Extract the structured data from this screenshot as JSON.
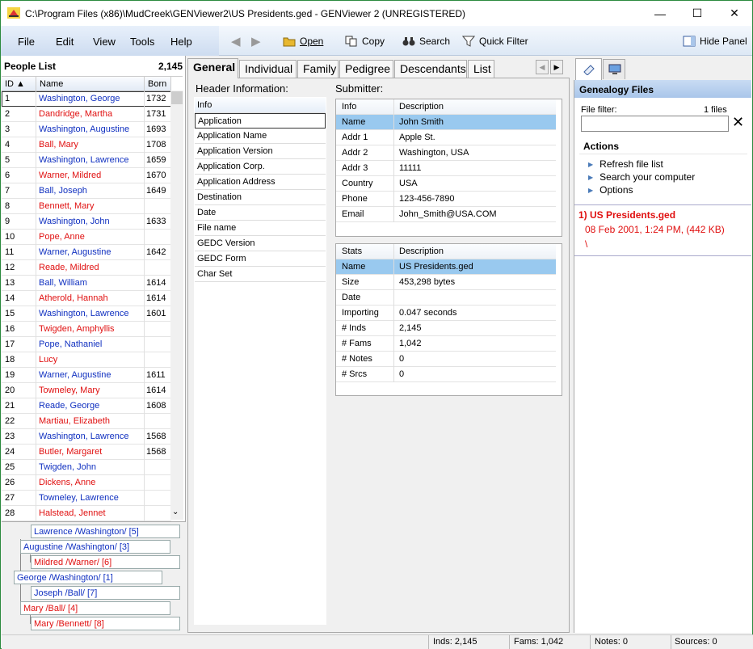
{
  "window": {
    "title": "C:\\Program Files (x86)\\MudCreek\\GENViewer2\\US Presidents.ged - GENViewer 2 (UNREGISTERED)",
    "minimize": "—",
    "maximize": "☐",
    "close": "✕"
  },
  "menu": [
    "File",
    "Edit",
    "View",
    "Tools",
    "Help"
  ],
  "toolbar": {
    "back": "◀",
    "forward": "▶",
    "open": "Open",
    "copy": "Copy",
    "search": "Search",
    "quick_filter": "Quick Filter",
    "hide_panel": "Hide Panel"
  },
  "people": {
    "title": "People List",
    "count": "2,145",
    "columns": [
      "ID ▲",
      "Name",
      "Born"
    ],
    "rows": [
      {
        "id": "1",
        "name": "Washington, George",
        "born": "1732",
        "sex": "male"
      },
      {
        "id": "2",
        "name": "Dandridge, Martha",
        "born": "1731",
        "sex": "female"
      },
      {
        "id": "3",
        "name": "Washington, Augustine",
        "born": "1693",
        "sex": "male"
      },
      {
        "id": "4",
        "name": "Ball, Mary",
        "born": "1708",
        "sex": "female"
      },
      {
        "id": "5",
        "name": "Washington, Lawrence",
        "born": "1659",
        "sex": "male"
      },
      {
        "id": "6",
        "name": "Warner, Mildred",
        "born": "1670",
        "sex": "female"
      },
      {
        "id": "7",
        "name": "Ball, Joseph",
        "born": "1649",
        "sex": "male"
      },
      {
        "id": "8",
        "name": "Bennett, Mary",
        "born": "",
        "sex": "female"
      },
      {
        "id": "9",
        "name": "Washington, John",
        "born": "1633",
        "sex": "male"
      },
      {
        "id": "10",
        "name": "Pope, Anne",
        "born": "",
        "sex": "female"
      },
      {
        "id": "11",
        "name": "Warner, Augustine",
        "born": "1642",
        "sex": "male"
      },
      {
        "id": "12",
        "name": "Reade, Mildred",
        "born": "",
        "sex": "female"
      },
      {
        "id": "13",
        "name": "Ball, William",
        "born": "1614",
        "sex": "male"
      },
      {
        "id": "14",
        "name": "Atherold, Hannah",
        "born": "1614",
        "sex": "female"
      },
      {
        "id": "15",
        "name": "Washington, Lawrence",
        "born": "1601",
        "sex": "male"
      },
      {
        "id": "16",
        "name": "Twigden, Amphyllis",
        "born": "",
        "sex": "female"
      },
      {
        "id": "17",
        "name": "Pope, Nathaniel",
        "born": "",
        "sex": "male"
      },
      {
        "id": "18",
        "name": "Lucy",
        "born": "",
        "sex": "female"
      },
      {
        "id": "19",
        "name": "Warner, Augustine",
        "born": "1611",
        "sex": "male"
      },
      {
        "id": "20",
        "name": "Towneley, Mary",
        "born": "1614",
        "sex": "female"
      },
      {
        "id": "21",
        "name": "Reade, George",
        "born": "1608",
        "sex": "male"
      },
      {
        "id": "22",
        "name": "Martiau, Elizabeth",
        "born": "",
        "sex": "female"
      },
      {
        "id": "23",
        "name": "Washington, Lawrence",
        "born": "1568",
        "sex": "male"
      },
      {
        "id": "24",
        "name": "Butler, Margaret",
        "born": "1568",
        "sex": "female"
      },
      {
        "id": "25",
        "name": "Twigden, John",
        "born": "",
        "sex": "male"
      },
      {
        "id": "26",
        "name": "Dickens, Anne",
        "born": "",
        "sex": "female"
      },
      {
        "id": "27",
        "name": "Towneley, Lawrence",
        "born": "",
        "sex": "male"
      },
      {
        "id": "28",
        "name": "Halstead, Jennet",
        "born": "",
        "sex": "female"
      }
    ]
  },
  "tree": [
    {
      "label": "Lawrence /Washington/ [5]",
      "sex": "male"
    },
    {
      "label": "Augustine /Washington/ [3]",
      "sex": "male"
    },
    {
      "label": "Mildred /Warner/ [6]",
      "sex": "female"
    },
    {
      "label": "George /Washington/ [1]",
      "sex": "male"
    },
    {
      "label": "Joseph /Ball/ [7]",
      "sex": "male"
    },
    {
      "label": "Mary /Ball/ [4]",
      "sex": "female"
    },
    {
      "label": "Mary /Bennett/ [8]",
      "sex": "female"
    }
  ],
  "tabs": [
    "General",
    "Individual",
    "Family",
    "Pedigree",
    "Descendants",
    "List"
  ],
  "tab_scroll": {
    "left": "◀",
    "right": "▶"
  },
  "general": {
    "header_label": "Header Information:",
    "submitter_label": "Submitter:",
    "header_items": [
      "Info",
      "Application",
      "Application Name",
      "Application Version",
      "Application Corp.",
      "Application Address",
      "Destination",
      "Date",
      "File name",
      "GEDC Version",
      "GEDC Form",
      "Char Set"
    ],
    "submitter": {
      "columns": [
        "Info",
        "Description"
      ],
      "rows": [
        [
          "Name",
          "John Smith"
        ],
        [
          "Addr 1",
          "Apple St."
        ],
        [
          "Addr 2",
          "Washington, USA"
        ],
        [
          "Addr 3",
          "11111"
        ],
        [
          "Country",
          "USA"
        ],
        [
          "Phone",
          "123-456-7890"
        ],
        [
          "Email",
          "John_Smith@USA.COM"
        ]
      ]
    },
    "stats": {
      "columns": [
        "Stats",
        "Description"
      ],
      "rows": [
        [
          "Name",
          "US Presidents.ged"
        ],
        [
          "Size",
          "453,298 bytes"
        ],
        [
          "Date",
          ""
        ],
        [
          "Importing",
          "0.047 seconds"
        ],
        [
          "# Inds",
          "2,145"
        ],
        [
          "# Fams",
          "1,042"
        ],
        [
          "# Notes",
          "0"
        ],
        [
          "# Srcs",
          "0"
        ]
      ]
    }
  },
  "right": {
    "title": "Genealogy Files",
    "file_filter_label": "File filter:",
    "file_count": "1 files",
    "file_filter_value": "",
    "clear": "✕",
    "actions_title": "Actions",
    "actions": [
      "Refresh file list",
      "Search your computer",
      "Options"
    ],
    "file": {
      "name": "1) US Presidents.ged",
      "meta": "08 Feb 2001, 1:24 PM, (442 KB)",
      "path": "\\"
    }
  },
  "status": {
    "inds": "Inds: 2,145",
    "fams": "Fams: 1,042",
    "notes": "Notes: 0",
    "sources": "Sources: 0"
  },
  "colors": {
    "male": "#1030c0",
    "female": "#e01010",
    "selection": "#99c9ef",
    "header_blue": "#a9c6ea"
  }
}
